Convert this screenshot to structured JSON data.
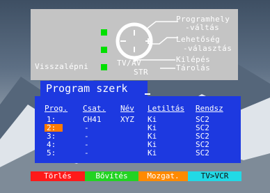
{
  "help": {
    "programhely": "Programhely",
    "valtas": "-váltás",
    "lehetoseg": "Lehetőség",
    "valasztas": "-választás",
    "kilepes": "Kilépés",
    "tarolas": "Tárolás",
    "visszalepni": "Visszalépni",
    "tvav": "TV/AV",
    "str": "STR"
  },
  "title": "Program szerk",
  "table": {
    "headers": [
      "Prog.",
      "Csat.",
      "Név",
      "Letiltás",
      "Rendsz"
    ],
    "rows": [
      [
        "1:",
        "CH41",
        "XYZ",
        "Ki",
        "SC2"
      ],
      [
        "2:",
        "-",
        "",
        "Ki",
        "SC2"
      ],
      [
        "3:",
        "-",
        "",
        "Ki",
        "SC2"
      ],
      [
        "4:",
        "-",
        "",
        "Ki",
        "SC2"
      ],
      [
        "5:",
        "-",
        "",
        "Ki",
        "SC2"
      ]
    ],
    "selected_row": 1
  },
  "buttons": [
    {
      "label": "Törlés",
      "color": "#ff1a1a"
    },
    {
      "label": "Bővítés",
      "color": "#22d322"
    },
    {
      "label": "Mozgat.",
      "color": "#ff8a00"
    },
    {
      "label": "TV>VCR",
      "color": "#22d9e6"
    }
  ]
}
